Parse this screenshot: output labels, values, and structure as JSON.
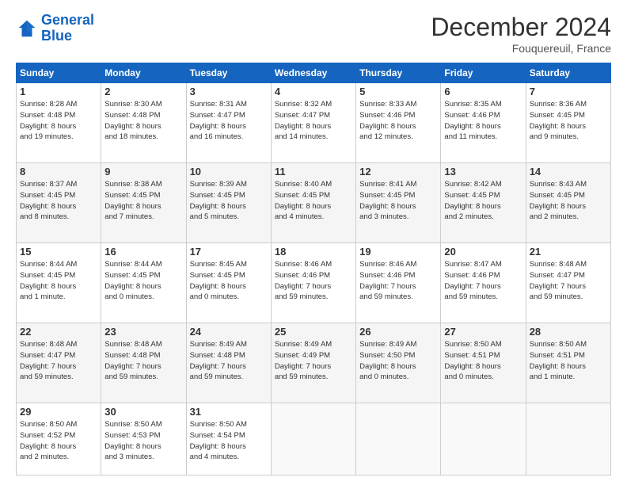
{
  "header": {
    "logo_line1": "General",
    "logo_line2": "Blue",
    "title": "December 2024",
    "subtitle": "Fouquereuil, France"
  },
  "columns": [
    "Sunday",
    "Monday",
    "Tuesday",
    "Wednesday",
    "Thursday",
    "Friday",
    "Saturday"
  ],
  "weeks": [
    [
      {
        "day": "1",
        "info": "Sunrise: 8:28 AM\nSunset: 4:48 PM\nDaylight: 8 hours\nand 19 minutes."
      },
      {
        "day": "2",
        "info": "Sunrise: 8:30 AM\nSunset: 4:48 PM\nDaylight: 8 hours\nand 18 minutes."
      },
      {
        "day": "3",
        "info": "Sunrise: 8:31 AM\nSunset: 4:47 PM\nDaylight: 8 hours\nand 16 minutes."
      },
      {
        "day": "4",
        "info": "Sunrise: 8:32 AM\nSunset: 4:47 PM\nDaylight: 8 hours\nand 14 minutes."
      },
      {
        "day": "5",
        "info": "Sunrise: 8:33 AM\nSunset: 4:46 PM\nDaylight: 8 hours\nand 12 minutes."
      },
      {
        "day": "6",
        "info": "Sunrise: 8:35 AM\nSunset: 4:46 PM\nDaylight: 8 hours\nand 11 minutes."
      },
      {
        "day": "7",
        "info": "Sunrise: 8:36 AM\nSunset: 4:45 PM\nDaylight: 8 hours\nand 9 minutes."
      }
    ],
    [
      {
        "day": "8",
        "info": "Sunrise: 8:37 AM\nSunset: 4:45 PM\nDaylight: 8 hours\nand 8 minutes."
      },
      {
        "day": "9",
        "info": "Sunrise: 8:38 AM\nSunset: 4:45 PM\nDaylight: 8 hours\nand 7 minutes."
      },
      {
        "day": "10",
        "info": "Sunrise: 8:39 AM\nSunset: 4:45 PM\nDaylight: 8 hours\nand 5 minutes."
      },
      {
        "day": "11",
        "info": "Sunrise: 8:40 AM\nSunset: 4:45 PM\nDaylight: 8 hours\nand 4 minutes."
      },
      {
        "day": "12",
        "info": "Sunrise: 8:41 AM\nSunset: 4:45 PM\nDaylight: 8 hours\nand 3 minutes."
      },
      {
        "day": "13",
        "info": "Sunrise: 8:42 AM\nSunset: 4:45 PM\nDaylight: 8 hours\nand 2 minutes."
      },
      {
        "day": "14",
        "info": "Sunrise: 8:43 AM\nSunset: 4:45 PM\nDaylight: 8 hours\nand 2 minutes."
      }
    ],
    [
      {
        "day": "15",
        "info": "Sunrise: 8:44 AM\nSunset: 4:45 PM\nDaylight: 8 hours\nand 1 minute."
      },
      {
        "day": "16",
        "info": "Sunrise: 8:44 AM\nSunset: 4:45 PM\nDaylight: 8 hours\nand 0 minutes."
      },
      {
        "day": "17",
        "info": "Sunrise: 8:45 AM\nSunset: 4:45 PM\nDaylight: 8 hours\nand 0 minutes."
      },
      {
        "day": "18",
        "info": "Sunrise: 8:46 AM\nSunset: 4:46 PM\nDaylight: 7 hours\nand 59 minutes."
      },
      {
        "day": "19",
        "info": "Sunrise: 8:46 AM\nSunset: 4:46 PM\nDaylight: 7 hours\nand 59 minutes."
      },
      {
        "day": "20",
        "info": "Sunrise: 8:47 AM\nSunset: 4:46 PM\nDaylight: 7 hours\nand 59 minutes."
      },
      {
        "day": "21",
        "info": "Sunrise: 8:48 AM\nSunset: 4:47 PM\nDaylight: 7 hours\nand 59 minutes."
      }
    ],
    [
      {
        "day": "22",
        "info": "Sunrise: 8:48 AM\nSunset: 4:47 PM\nDaylight: 7 hours\nand 59 minutes."
      },
      {
        "day": "23",
        "info": "Sunrise: 8:48 AM\nSunset: 4:48 PM\nDaylight: 7 hours\nand 59 minutes."
      },
      {
        "day": "24",
        "info": "Sunrise: 8:49 AM\nSunset: 4:48 PM\nDaylight: 7 hours\nand 59 minutes."
      },
      {
        "day": "25",
        "info": "Sunrise: 8:49 AM\nSunset: 4:49 PM\nDaylight: 7 hours\nand 59 minutes."
      },
      {
        "day": "26",
        "info": "Sunrise: 8:49 AM\nSunset: 4:50 PM\nDaylight: 8 hours\nand 0 minutes."
      },
      {
        "day": "27",
        "info": "Sunrise: 8:50 AM\nSunset: 4:51 PM\nDaylight: 8 hours\nand 0 minutes."
      },
      {
        "day": "28",
        "info": "Sunrise: 8:50 AM\nSunset: 4:51 PM\nDaylight: 8 hours\nand 1 minute."
      }
    ],
    [
      {
        "day": "29",
        "info": "Sunrise: 8:50 AM\nSunset: 4:52 PM\nDaylight: 8 hours\nand 2 minutes."
      },
      {
        "day": "30",
        "info": "Sunrise: 8:50 AM\nSunset: 4:53 PM\nDaylight: 8 hours\nand 3 minutes."
      },
      {
        "day": "31",
        "info": "Sunrise: 8:50 AM\nSunset: 4:54 PM\nDaylight: 8 hours\nand 4 minutes."
      },
      {
        "day": "",
        "info": ""
      },
      {
        "day": "",
        "info": ""
      },
      {
        "day": "",
        "info": ""
      },
      {
        "day": "",
        "info": ""
      }
    ]
  ]
}
